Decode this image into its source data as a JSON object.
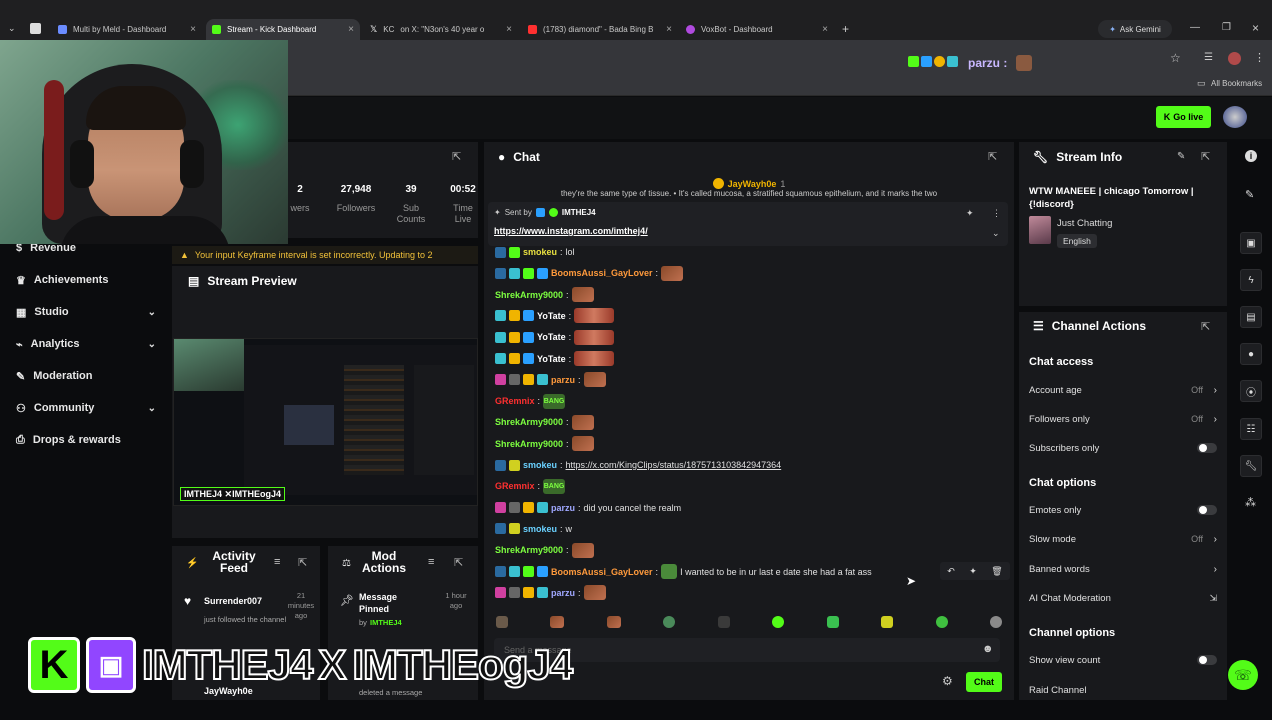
{
  "browser": {
    "tabs": [
      {
        "label": "Multi by Meld - Dashboard",
        "color": "#6b8cff"
      },
      {
        "label": "Stream - Kick Dashboard",
        "color": "#53fc18"
      },
      {
        "label": "on X: \"N3on's 40 year o",
        "prefix": "KC",
        "color": "#cccccc"
      },
      {
        "label": "(1783) diamond\" - Bada Bing B",
        "color": "#ff3030"
      },
      {
        "label": "VoxBot - Dashboard",
        "color": "#b04adf"
      }
    ],
    "new_tab": "+",
    "ask_gemini": "Ask Gemini",
    "bookmarks_label": "All Bookmarks",
    "profile_name": "parzu :"
  },
  "topnav": {
    "go_live": "Go live"
  },
  "stats": [
    {
      "value": "2",
      "label": "wers"
    },
    {
      "value": "27,948",
      "label": "Followers"
    },
    {
      "value": "39",
      "label": "Sub Counts"
    },
    {
      "value": "00:52",
      "label": "Time Live"
    }
  ],
  "leftnav": [
    {
      "label": "Revenue",
      "icon": "revenue-icon",
      "chev": false
    },
    {
      "label": "Achievements",
      "icon": "trophy-icon",
      "chev": false
    },
    {
      "label": "Studio",
      "icon": "studio-icon",
      "chev": true
    },
    {
      "label": "Analytics",
      "icon": "analytics-icon",
      "chev": true
    },
    {
      "label": "Moderation",
      "icon": "moderation-icon",
      "chev": false
    },
    {
      "label": "Community",
      "icon": "community-icon",
      "chev": true
    },
    {
      "label": "Drops & rewards",
      "icon": "drops-icon",
      "chev": false
    }
  ],
  "warning": "Your input Keyframe interval is set incorrectly. Updating to 2",
  "stream_preview": {
    "title": "Stream Preview"
  },
  "activity_feed": {
    "title": "Activity Feed",
    "item_user": "Surrender007",
    "item_time": "21 minutes ago",
    "item_text": "just followed the channel",
    "next_user": "JayWayh0e"
  },
  "mod_actions": {
    "title": "Mod Actions",
    "item_title": "Message Pinned",
    "item_by_prefix": "by",
    "item_by": "IMTHEJ4",
    "item_time": "1 hour ago",
    "next_text": "deleted a message"
  },
  "overlay": {
    "left": "IMTHEJ4",
    "right": "IMTHEogJ4"
  },
  "chat": {
    "title": "Chat",
    "top_user": "JayWayh0e",
    "top_count": "1",
    "top_text": "they're the same type of tissue. • It's called mucosa, a stratified squamous epithelium, and it marks the two",
    "pinned_sent_by": "Sent by",
    "pinned_user": "IMTHEJ4",
    "pinned_link": "https://www.instagram.com/imthej4/",
    "lines": [
      {
        "user": "smokeu",
        "color": "#e8e040",
        "text": "lol",
        "kind": "text"
      },
      {
        "user": "BoomsAussi_GayLover",
        "color": "#ff9a3c",
        "text": "",
        "kind": "emote"
      },
      {
        "user": "ShrekArmy9000",
        "color": "#7dff40",
        "text": "",
        "kind": "emote"
      },
      {
        "user": "YoTate",
        "color": "#ffffff",
        "text": "",
        "kind": "wide"
      },
      {
        "user": "YoTate",
        "color": "#ffffff",
        "text": "",
        "kind": "wide"
      },
      {
        "user": "YoTate",
        "color": "#ffffff",
        "text": "",
        "kind": "wide"
      },
      {
        "user": "parzu",
        "color": "#ff9a3c",
        "text": "",
        "kind": "emote"
      },
      {
        "user": "GRemnix",
        "color": "#ff3030",
        "text": "BANG",
        "kind": "green"
      },
      {
        "user": "ShrekArmy9000",
        "color": "#7dff40",
        "text": "",
        "kind": "emote"
      },
      {
        "user": "ShrekArmy9000",
        "color": "#7dff40",
        "text": "",
        "kind": "emote"
      },
      {
        "user": "smokeu",
        "color": "#6ad1ff",
        "text": "https://x.com/KingClips/status/1875713103842947364",
        "kind": "link"
      },
      {
        "user": "GRemnix",
        "color": "#ff3030",
        "text": "BANG",
        "kind": "green"
      },
      {
        "user": "parzu",
        "color": "#a0a8ff",
        "text": "did you cancel the realm",
        "kind": "text"
      },
      {
        "user": "smokeu",
        "color": "#6ad1ff",
        "text": "w",
        "kind": "text"
      },
      {
        "user": "ShrekArmy9000",
        "color": "#7dff40",
        "text": "",
        "kind": "emote"
      },
      {
        "user": "BoomsAussi_GayLover",
        "color": "#ff9a3c",
        "text": "I wanted to be in ur last e date she had a fat ass",
        "kind": "text"
      },
      {
        "user": "parzu",
        "color": "#a0a8ff",
        "text": "",
        "kind": "emote"
      }
    ],
    "send_label": "Chat",
    "input_placeholder": "Send a message"
  },
  "stream_info": {
    "title": "Stream Info",
    "stream_title": "WTW MANEEE | chicago Tomorrow | {!discord}",
    "category": "Just Chatting",
    "language": "English"
  },
  "channel_actions": {
    "title": "Channel Actions",
    "chat_access": "Chat access",
    "account_age": "Account age",
    "account_age_val": "Off",
    "followers_only": "Followers only",
    "followers_only_val": "Off",
    "subscribers_only": "Subscribers only",
    "chat_options": "Chat options",
    "emotes_only": "Emotes only",
    "slow_mode": "Slow mode",
    "slow_mode_val": "Off",
    "banned_words": "Banned words",
    "ai_moderation": "AI Chat Moderation",
    "channel_options": "Channel options",
    "show_view_count": "Show view count",
    "raid_channel": "Raid Channel"
  }
}
